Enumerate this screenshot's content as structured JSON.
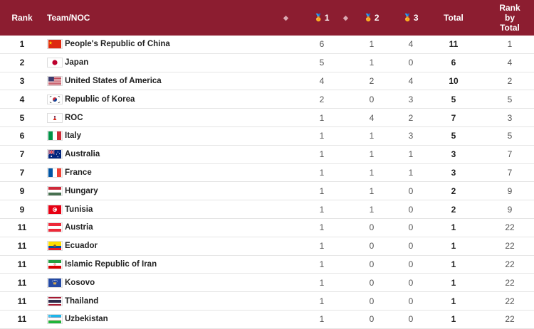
{
  "header": {
    "rank": "Rank",
    "team": "Team/NOC",
    "gold": "1",
    "silver": "2",
    "bronze": "3",
    "total": "Total",
    "rank_by_total": [
      "Rank",
      "by",
      "Total"
    ]
  },
  "colors": {
    "header_bg": "#8c1d30",
    "header_text": "#ffffff"
  },
  "rows": [
    {
      "rank": "1",
      "team": "People's Republic of China",
      "flag": "china",
      "gold": "6",
      "silver": "1",
      "bronze": "4",
      "total": "11",
      "rbt": "1"
    },
    {
      "rank": "2",
      "team": "Japan",
      "flag": "japan",
      "gold": "5",
      "silver": "1",
      "bronze": "0",
      "total": "6",
      "rbt": "4"
    },
    {
      "rank": "3",
      "team": "United States of America",
      "flag": "usa",
      "gold": "4",
      "silver": "2",
      "bronze": "4",
      "total": "10",
      "rbt": "2"
    },
    {
      "rank": "4",
      "team": "Republic of Korea",
      "flag": "korea",
      "gold": "2",
      "silver": "0",
      "bronze": "3",
      "total": "5",
      "rbt": "5"
    },
    {
      "rank": "5",
      "team": "ROC",
      "flag": "roc",
      "gold": "1",
      "silver": "4",
      "bronze": "2",
      "total": "7",
      "rbt": "3"
    },
    {
      "rank": "6",
      "team": "Italy",
      "flag": "italy",
      "gold": "1",
      "silver": "1",
      "bronze": "3",
      "total": "5",
      "rbt": "5"
    },
    {
      "rank": "7",
      "team": "Australia",
      "flag": "australia",
      "gold": "1",
      "silver": "1",
      "bronze": "1",
      "total": "3",
      "rbt": "7"
    },
    {
      "rank": "7",
      "team": "France",
      "flag": "france",
      "gold": "1",
      "silver": "1",
      "bronze": "1",
      "total": "3",
      "rbt": "7"
    },
    {
      "rank": "9",
      "team": "Hungary",
      "flag": "hungary",
      "gold": "1",
      "silver": "1",
      "bronze": "0",
      "total": "2",
      "rbt": "9"
    },
    {
      "rank": "9",
      "team": "Tunisia",
      "flag": "tunisia",
      "gold": "1",
      "silver": "1",
      "bronze": "0",
      "total": "2",
      "rbt": "9"
    },
    {
      "rank": "11",
      "team": "Austria",
      "flag": "austria",
      "gold": "1",
      "silver": "0",
      "bronze": "0",
      "total": "1",
      "rbt": "22"
    },
    {
      "rank": "11",
      "team": "Ecuador",
      "flag": "ecuador",
      "gold": "1",
      "silver": "0",
      "bronze": "0",
      "total": "1",
      "rbt": "22"
    },
    {
      "rank": "11",
      "team": "Islamic Republic of Iran",
      "flag": "iran",
      "gold": "1",
      "silver": "0",
      "bronze": "0",
      "total": "1",
      "rbt": "22"
    },
    {
      "rank": "11",
      "team": "Kosovo",
      "flag": "kosovo",
      "gold": "1",
      "silver": "0",
      "bronze": "0",
      "total": "1",
      "rbt": "22"
    },
    {
      "rank": "11",
      "team": "Thailand",
      "flag": "thailand",
      "gold": "1",
      "silver": "0",
      "bronze": "0",
      "total": "1",
      "rbt": "22"
    },
    {
      "rank": "11",
      "team": "Uzbekistan",
      "flag": "uzbekistan",
      "gold": "1",
      "silver": "0",
      "bronze": "0",
      "total": "1",
      "rbt": "22"
    }
  ]
}
